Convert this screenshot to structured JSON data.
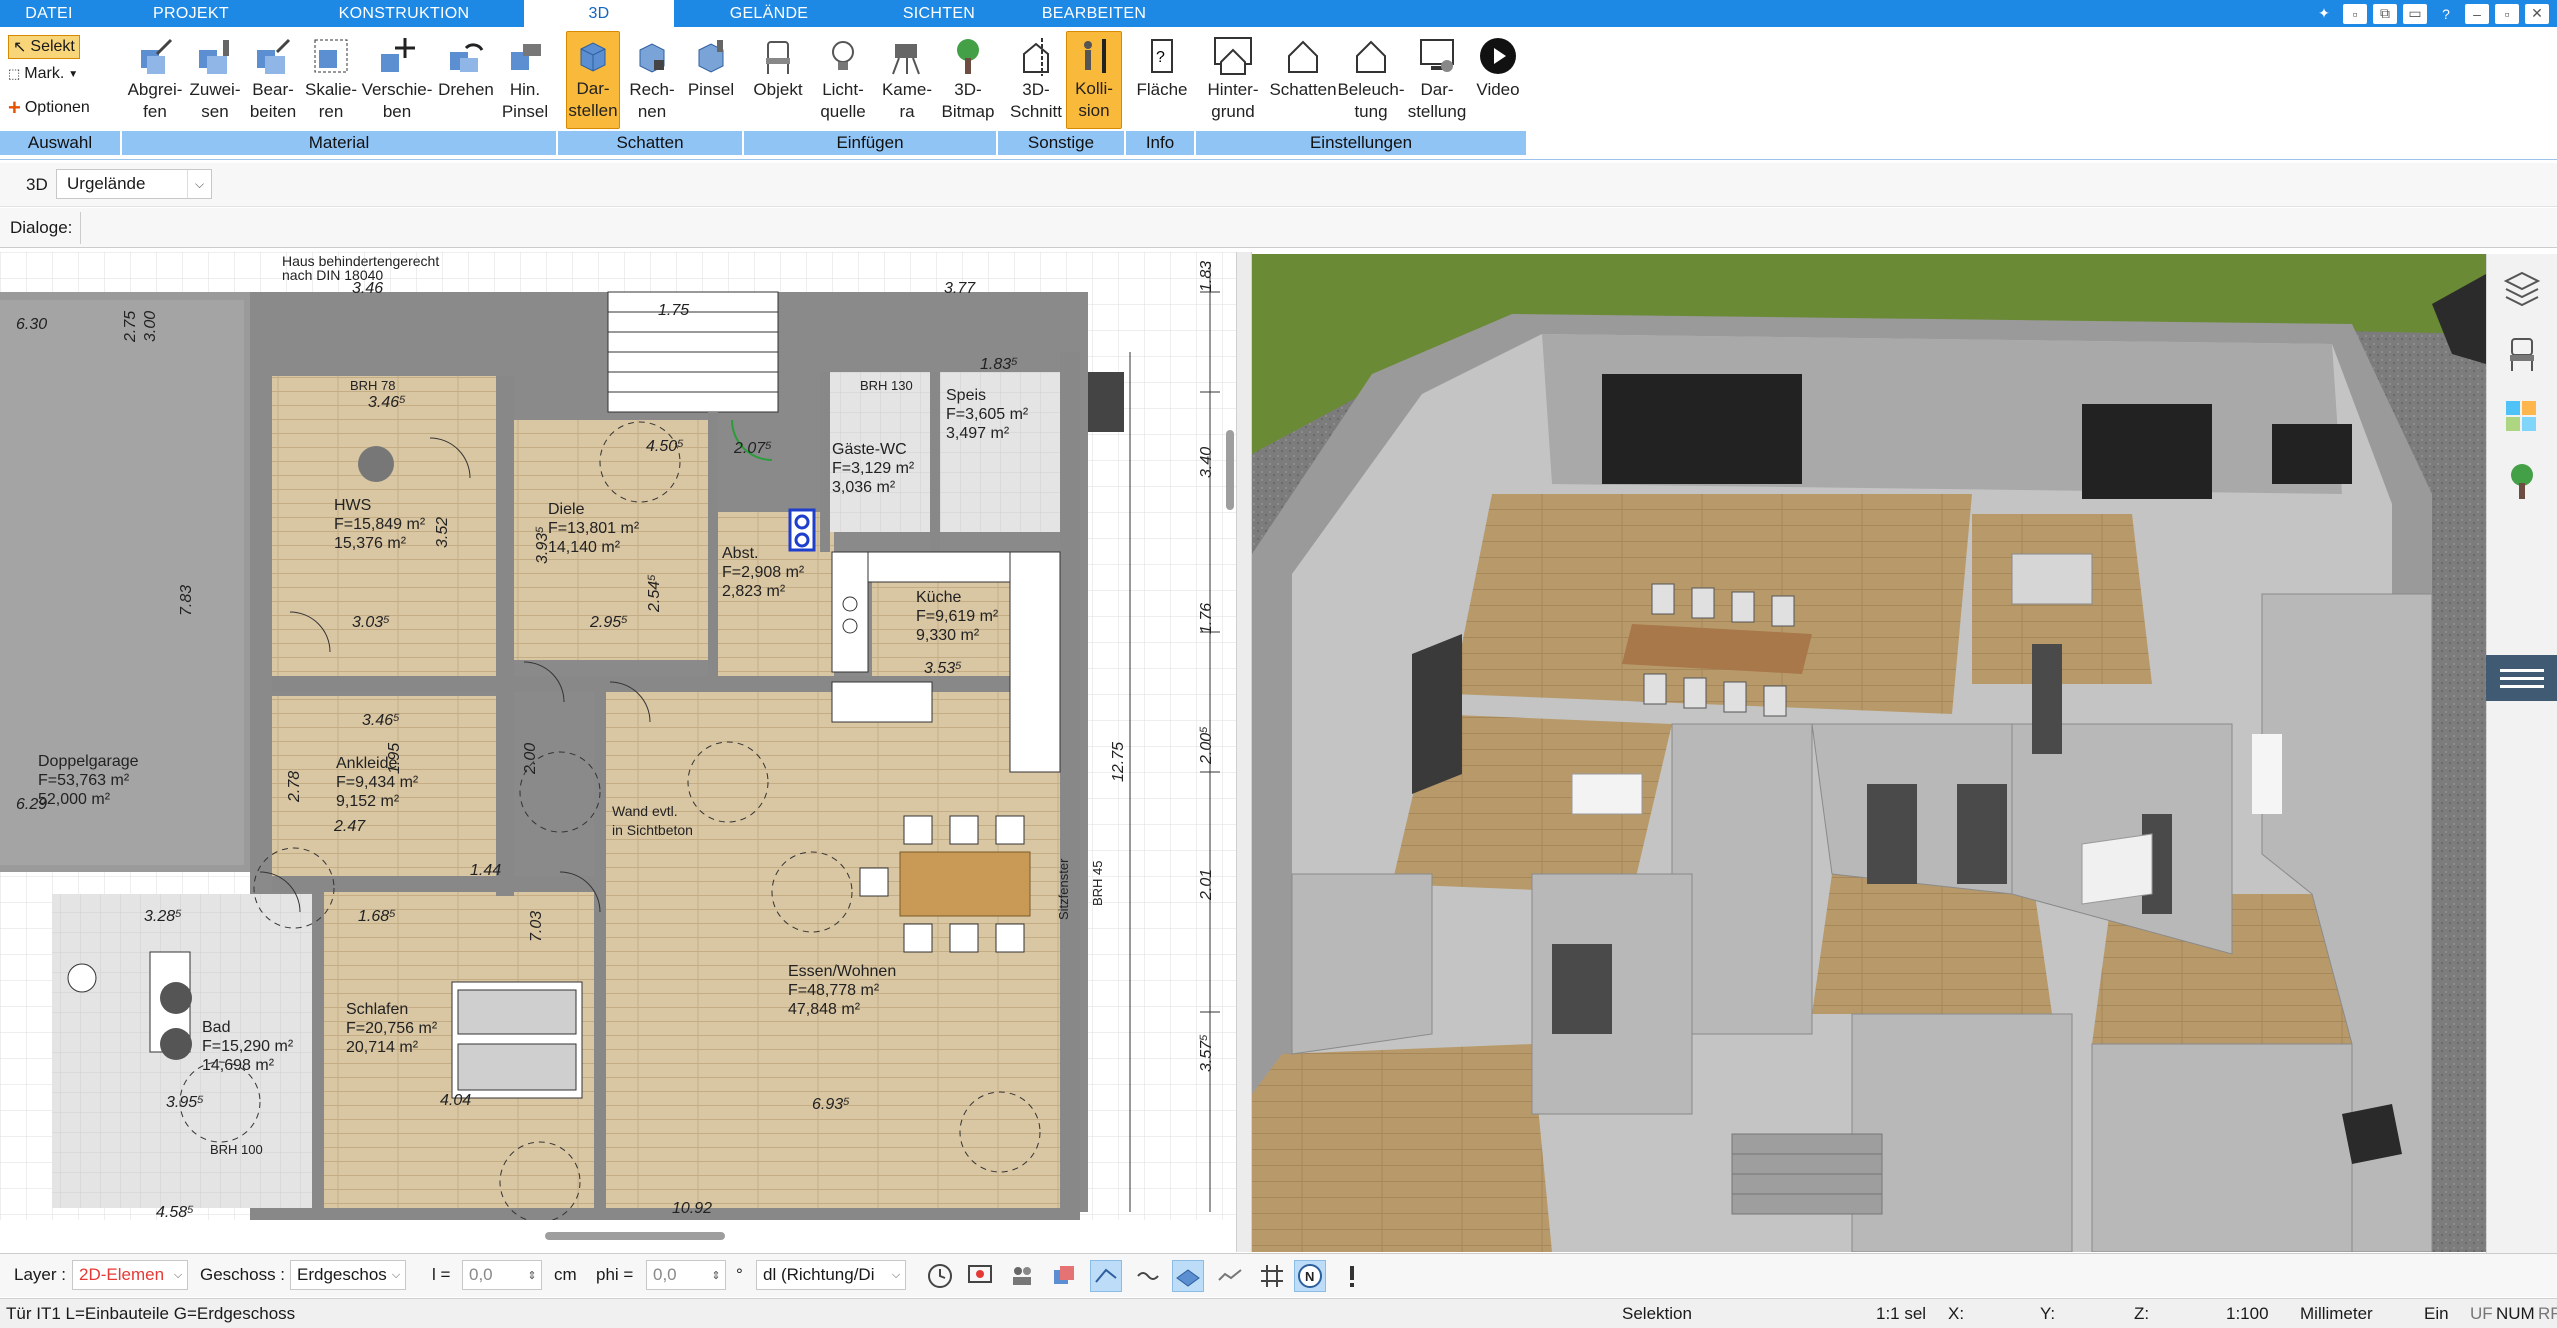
{
  "menu": {
    "tabs": [
      {
        "label": "DATEI"
      },
      {
        "label": "PROJEKT"
      },
      {
        "label": "KONSTRUKTION"
      },
      {
        "label": "3D"
      },
      {
        "label": "GELÄNDE"
      },
      {
        "label": "SICHTEN"
      },
      {
        "label": "BEARBEITEN"
      }
    ],
    "active_tab": "3D"
  },
  "ribbon": {
    "auswahl": {
      "selekt": "Selekt",
      "mark": "Mark.",
      "optionen": "Optionen"
    },
    "material": [
      {
        "line1": "Abgrei-",
        "line2": "fen"
      },
      {
        "line1": "Zuwei-",
        "line2": "sen"
      },
      {
        "line1": "Bear-",
        "line2": "beiten"
      },
      {
        "line1": "Skalie-",
        "line2": "ren"
      },
      {
        "line1": "Verschie-",
        "line2": "ben"
      },
      {
        "line1": "Drehen",
        "line2": ""
      },
      {
        "line1": "Hin.",
        "line2": "Pinsel"
      }
    ],
    "schatten": [
      {
        "line1": "Dar-",
        "line2": "stellen"
      },
      {
        "line1": "Rech-",
        "line2": "nen"
      },
      {
        "line1": "Pinsel",
        "line2": ""
      }
    ],
    "einfuegen": [
      {
        "line1": "Objekt",
        "line2": ""
      },
      {
        "line1": "Licht-",
        "line2": "quelle"
      },
      {
        "line1": "Kame-",
        "line2": "ra"
      },
      {
        "line1": "3D-",
        "line2": "Bitmap"
      }
    ],
    "sonstige": [
      {
        "line1": "3D-",
        "line2": "Schnitt"
      },
      {
        "line1": "Kolli-",
        "line2": "sion"
      }
    ],
    "info": [
      {
        "line1": "Fläche",
        "line2": ""
      }
    ],
    "einstellungen": [
      {
        "line1": "Hinter-",
        "line2": "grund"
      },
      {
        "line1": "Schatten",
        "line2": ""
      },
      {
        "line1": "Beleuch-",
        "line2": "tung"
      },
      {
        "line1": "Dar-",
        "line2": "stellung"
      },
      {
        "line1": "Video",
        "line2": ""
      }
    ],
    "groups": {
      "auswahl": "Auswahl",
      "material": "Material",
      "schatten": "Schatten",
      "einfuegen": "Einfügen",
      "sonstige": "Sonstige",
      "info": "Info",
      "einstellungen": "Einstellungen"
    }
  },
  "toolbar": {
    "mode": "3D",
    "terrain_value": "Urgelände",
    "dialoge_label": "Dialoge:"
  },
  "plan": {
    "rooms": [
      {
        "name": "HWS",
        "area1": "F=15,849 m²",
        "area2": "15,376 m²"
      },
      {
        "name": "Diele",
        "area1": "F=13,801 m²",
        "area2": "14,140 m²"
      },
      {
        "name": "Speis",
        "area1": "F=3,605 m²",
        "area2": "3,497 m²"
      },
      {
        "name": "Gäste-WC",
        "area1": "F=3,129 m²",
        "area2": "3,036 m²"
      },
      {
        "name": "Abst.",
        "area1": "F=2,908 m²",
        "area2": "2,823 m²"
      },
      {
        "name": "Küche",
        "area1": "F=9,619 m²",
        "area2": "9,330 m²"
      },
      {
        "name": "Doppelgarage",
        "area1": "F=53,763 m²",
        "area2": "52,000 m²"
      },
      {
        "name": "Ankleide",
        "area1": "F=9,434 m²",
        "area2": "9,152 m²"
      },
      {
        "name": "Schlafen",
        "area1": "F=20,756 m²",
        "area2": "20,714 m²"
      },
      {
        "name": "Bad",
        "area1": "F=15,290 m²",
        "area2": "14,698 m²"
      },
      {
        "name": "Essen/Wohnen",
        "area1": "F=48,778 m²",
        "area2": "47,848 m²"
      }
    ],
    "notes": {
      "header": "Haus behindertengerecht",
      "header2": "nach DIN 18040",
      "wall_note1": "Wand evtl.",
      "wall_note2": "in Sichtbeton",
      "sitzfenster": "Sitzfenster",
      "brh45": "BRH 45",
      "brh100": "BRH 100",
      "brh78": "BRH 78",
      "brh130": "BRH 130"
    },
    "dims_h": [
      "3.46",
      "3.77",
      "6.30",
      "4.50⁵",
      "2.95⁵",
      "3.03⁵",
      "1.83⁵",
      "3.46⁵",
      "3.53⁵",
      "3.28⁵",
      "1.68⁵",
      "4.04",
      "6.93⁵",
      "3.95⁵",
      "4.58⁵",
      "10.92",
      "2.47",
      "1.75",
      "1.44",
      "3.46⁵",
      "2.07⁵",
      "6.29"
    ],
    "dims_v": [
      "1.83",
      "3.40",
      "1.76",
      "2.00⁵",
      "2.01",
      "3.57⁵",
      "12.75",
      "7.83",
      "3.52",
      "3.93⁵",
      "2.78",
      "7.03",
      "1.95",
      "2.00",
      "2.54⁵",
      "3.00",
      "2.75"
    ]
  },
  "bottom": {
    "layer_label": "Layer :",
    "layer_value": "2D-Elemen",
    "geschoss_label": "Geschoss :",
    "geschoss_value": "Erdgeschos",
    "l_label": "l =",
    "l_value": "0,0",
    "l_unit": "cm",
    "phi_label": "phi =",
    "phi_value": "0,0",
    "phi_unit": "°",
    "dl_value": "dl (Richtung/Di"
  },
  "status": {
    "left": "Tür IT1 L=Einbauteile G=Erdgeschoss",
    "mode": "Selektion",
    "scale_sel": "1:1 sel",
    "x": "X:",
    "y": "Y:",
    "z": "Z:",
    "scale": "1:100",
    "unit": "Millimeter",
    "ein": "Ein",
    "flags": [
      "UF",
      "NUM",
      "RF"
    ]
  },
  "colors": {
    "accent": "#1e88e5",
    "group_bar": "#90c4f5",
    "active_button": "#f9b93a",
    "floor_wood": "#b89a6a",
    "wall_grey": "#8f8f8f",
    "grass": "#5a7a2e"
  },
  "icons": [
    "arrow-select-icon",
    "mark-icon",
    "plus-icon",
    "eyedropper-icon",
    "brush-icon",
    "scale-icon",
    "move-icon",
    "rotate-icon",
    "cube-shadow-icon",
    "chair-icon",
    "bulb-icon",
    "camera-icon",
    "tree-icon",
    "section-icon",
    "collision-icon",
    "area-icon",
    "house-icon",
    "monitor-icon",
    "play-icon",
    "layers-icon",
    "color-swatch-icon",
    "hamburger-icon"
  ]
}
